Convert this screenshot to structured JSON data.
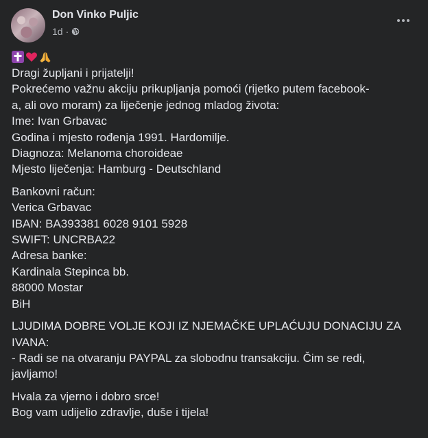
{
  "post": {
    "author": "Don Vinko Puljic",
    "time": "1d",
    "separator": "·",
    "emojis": [
      "cross-emoji",
      "red-heart-emoji",
      "praying-hands-emoji"
    ],
    "paragraphs": [
      [
        "Dragi župljani i prijatelji!",
        "Pokrećemo važnu akciju prikupljanja pomoći (rijetko putem facebook-",
        "a, ali ovo moram) za liječenje jednog mladog života:",
        "Ime: Ivan Grbavac",
        "Godina i mjesto rođenja 1991. Hardomilje.",
        "Diagnoza: Melanoma choroideae",
        "Mjesto liječenja: Hamburg - Deutschland"
      ],
      [
        "Bankovni račun:",
        "Verica Grbavac",
        "IBAN: BA393381 6028 9101 5928",
        "SWIFT: UNCRBA22",
        "Adresa banke:",
        "Kardinala Stepinca bb.",
        "88000 Mostar",
        "BiH"
      ],
      [
        "LJUDIMA DOBRE VOLJE KOJI IZ NJEMAČKE UPLAĆUJU DONACIJU ZA",
        "IVANA:",
        "- Radi se na otvaranju PAYPAL za slobodnu transakciju. Čim se redi,",
        "javljamo!"
      ],
      [
        "Hvala za vjerno i dobro srce!",
        "Bog vam udijelio zdravlje, duše i tijela!"
      ]
    ]
  },
  "colors": {
    "background": "#242526",
    "text": "#e4e6eb",
    "secondary": "#b0b3b8"
  }
}
